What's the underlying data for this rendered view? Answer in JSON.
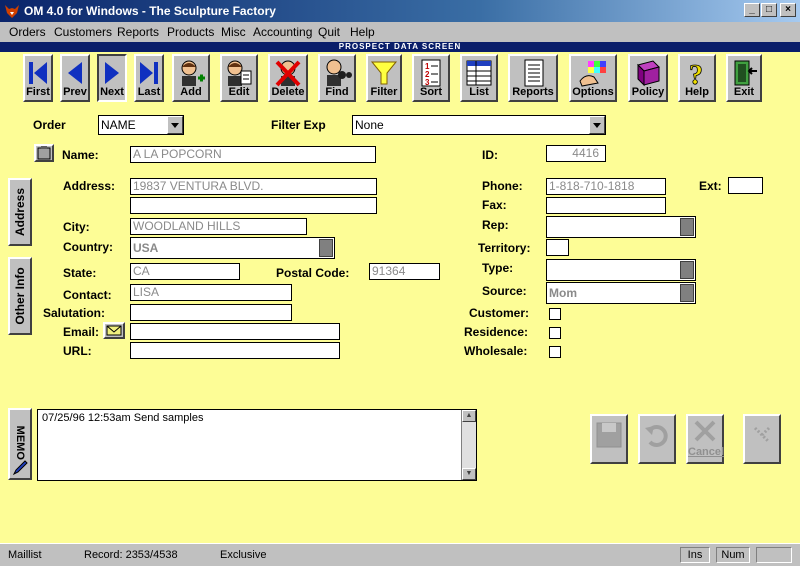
{
  "window": {
    "title": "OM 4.0 for Windows - The Sculpture Factory"
  },
  "menu": [
    "Orders",
    "Customers",
    "Reports",
    "Products",
    "Misc",
    "Accounting",
    "Quit",
    "Help"
  ],
  "screen_title": "PROSPECT DATA SCREEN",
  "toolbar": {
    "first": "First",
    "prev": "Prev",
    "next": "Next",
    "last": "Last",
    "add": "Add",
    "edit": "Edit",
    "delete": "Delete",
    "find": "Find",
    "filter": "Filter",
    "sort": "Sort",
    "list": "List",
    "reports": "Reports",
    "options": "Options",
    "policy": "Policy",
    "help": "Help",
    "exit": "Exit"
  },
  "order": {
    "label": "Order",
    "value": "NAME"
  },
  "filter_exp": {
    "label": "Filter Exp",
    "value": "None"
  },
  "tabs": {
    "address": "Address",
    "other_info": "Other Info",
    "memo": "MEMO"
  },
  "form": {
    "name_label": "Name:",
    "name": "A LA POPCORN",
    "id_label": "ID:",
    "id": "4416",
    "address_label": "Address:",
    "address1": "19837 VENTURA BLVD.",
    "address2": "",
    "phone_label": "Phone:",
    "phone": "1-818-710-1818",
    "ext_label": "Ext:",
    "ext": "",
    "fax_label": "Fax:",
    "fax": "",
    "city_label": "City:",
    "city": "WOODLAND HILLS",
    "rep_label": "Rep:",
    "rep": "",
    "country_label": "Country:",
    "country": "USA",
    "territory_label": "Territory:",
    "territory": "",
    "state_label": "State:",
    "state": "CA",
    "postal_label": "Postal Code:",
    "postal": "91364",
    "type_label": "Type:",
    "type": "",
    "contact_label": "Contact:",
    "contact": "LISA",
    "source_label": "Source:",
    "source": "Mom",
    "salutation_label": "Salutation:",
    "salutation": "",
    "customer_label": "Customer:",
    "email_label": "Email:",
    "email": "",
    "residence_label": "Residence:",
    "url_label": "URL:",
    "url": "",
    "wholesale_label": "Wholesale:"
  },
  "memo": {
    "text": "07/25/96  12:53am Send samples"
  },
  "actions": {
    "cancel": "Cancel"
  },
  "status": {
    "left": "Maillist",
    "record": "Record: 2353/4538",
    "mode": "Exclusive",
    "ins": "Ins",
    "num": "Num"
  }
}
